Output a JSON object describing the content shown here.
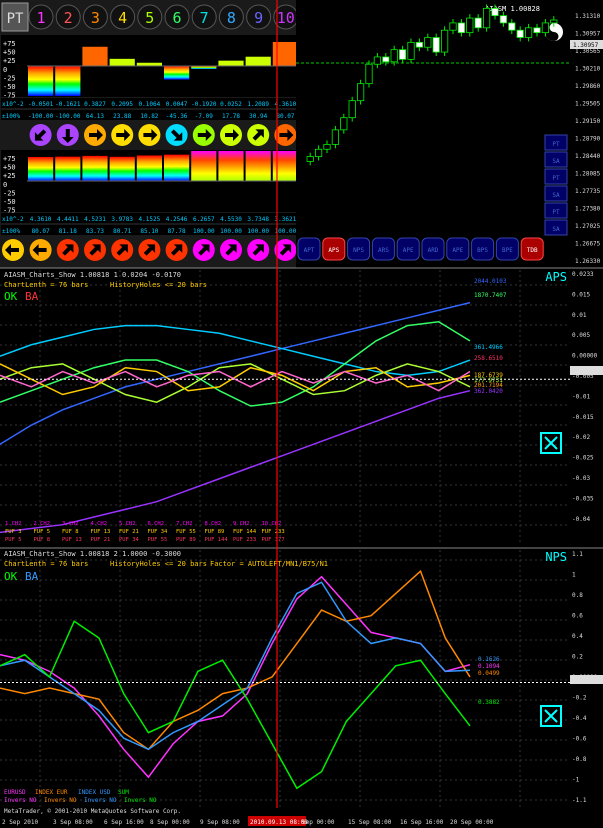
{
  "header": {
    "pt_label": "PT",
    "numbers": [
      "1",
      "2",
      "3",
      "4",
      "5",
      "6",
      "7",
      "8",
      "9",
      "10"
    ],
    "number_colors": [
      "#ff33ff",
      "#ff5555",
      "#ff8800",
      "#ffdd00",
      "#aaff00",
      "#33ff66",
      "#00e0e0",
      "#33aaff",
      "#6666ff",
      "#cc33ff"
    ]
  },
  "top_panel": {
    "yaxis_labels": [
      "+75",
      "+50",
      "+25",
      "0",
      "-25",
      "-50",
      "-75"
    ],
    "row1_prefix": "x10^-2",
    "row1_values": [
      "-0.0501",
      "-0.1621",
      "0.3827",
      "0.2095",
      "0.1064",
      "0.0047",
      "-0.1920",
      "0.0252",
      "1.2089",
      "4.3610"
    ],
    "row2_prefix": "±100%",
    "row2_values": [
      "-100.00",
      "-100.00",
      "64.13",
      "23.88",
      "10.82",
      "-45.36",
      "-7.09",
      "17.78",
      "30.94",
      "80.07"
    ],
    "row3_prefix": "x10^-2",
    "row3_values": [
      "4.3610",
      "4.4411",
      "4.5231",
      "3.9783",
      "4.1525",
      "4.2546",
      "6.2657",
      "4.5530",
      "3.7348",
      "3.3621"
    ],
    "row4_prefix": "±100%",
    "row4_values": [
      "80.07",
      "81.18",
      "83.73",
      "80.71",
      "85.10",
      "87.78",
      "100.00",
      "100.00",
      "100.00",
      "100.00"
    ],
    "arrow_icons_1": [
      "arrow-down-left-icon",
      "arrow-down-icon",
      "arrow-right-icon",
      "arrow-right-icon",
      "arrow-right-icon",
      "arrow-down-right-icon",
      "arrow-right-icon",
      "arrow-right-icon",
      "arrow-up-right-icon",
      "arrow-right-icon"
    ],
    "arrow_icons_2": [
      "arrow-left-icon",
      "arrow-up-right-icon",
      "arrow-up-right-icon",
      "arrow-up-right-icon",
      "arrow-up-right-icon",
      "arrow-up-right-icon",
      "arrow-up-right-icon",
      "arrow-up-right-icon",
      "arrow-up-right-icon",
      "arrow-up-right-icon"
    ]
  },
  "price_panel": {
    "title": "AIASM 1.00828",
    "price_labels": [
      "1.31310",
      "1.30957",
      "1.30565",
      "1.30210",
      "1.29860",
      "1.29505",
      "1.29150",
      "1.28790",
      "1.28440",
      "1.28085",
      "1.27735",
      "1.27380",
      "1.27025",
      "1.26675",
      "1.26330"
    ],
    "current_price": "1.30957",
    "buttons": [
      "APT",
      "APS",
      "NPS",
      "ARS",
      "APE",
      "ARD",
      "APE",
      "BPS",
      "BPE",
      "TDB"
    ],
    "side_buttons": [
      "PT",
      "SA",
      "PT",
      "SA",
      "PT",
      "SA"
    ]
  },
  "aps_panel": {
    "header": "AIASM_Charts_Show 1.00818  1  0.0204  -0.0170",
    "chart_length": "ChartLenth = 76 bars",
    "history": "HistoryHoles <= 20 bars",
    "ok_label": "OK",
    "ba_label": "BA",
    "badge": "APS",
    "badge_value": "0.0233",
    "yaxis_labels": [
      "0.0233",
      "0.015",
      "0.01",
      "0.005",
      "0.00000",
      "-0.005",
      "-0.01",
      "-0.015",
      "-0.02",
      "-0.025",
      "-0.03",
      "-0.035",
      "-0.04"
    ],
    "right_values": [
      "2044.0103",
      "1870.7407",
      "361.4966",
      "258.6510",
      "187.6739",
      "177.9731",
      "201.7194",
      "362.0420"
    ],
    "legend_row1": [
      "1.CH2",
      "2.CH2",
      "3.CH2",
      "4.CH2",
      "5.CH2",
      "6.CH2",
      "7.CH2",
      "8.CH2",
      "9.CH2",
      "10.CH2"
    ],
    "legend_row2": [
      "FUF 3",
      "FUF 5",
      "FUF 8",
      "FUF 13",
      "FUF 21",
      "FUF 34",
      "FUF 55",
      "FUF 89",
      "FUF 144",
      "FUF 233"
    ],
    "legend_row3": [
      "PUF 5",
      "PUF 8",
      "PUF 13",
      "PUF 21",
      "PUF 34",
      "PUF 55",
      "PUF 89",
      "PUF 144",
      "PUF 233",
      "PUF 377"
    ]
  },
  "nps_panel": {
    "header": "AIASM_Charts_Show 1.00818  2  1.0000  -0.3000",
    "chart_length": "ChartLenth = 76 bars",
    "history": "HistoryHoles <= 20 bars",
    "factor": "Factor = AUTOLEFT/MN1/B75/N1",
    "ok_label": "OK",
    "ba_label": "BA",
    "badge": "NPS",
    "yaxis_labels": [
      "1.1",
      "1",
      "0.8",
      "0.6",
      "0.4",
      "0.2",
      "0.00000",
      "-0.2",
      "-0.4",
      "-0.6",
      "-0.8",
      "-1",
      "-1.1"
    ],
    "right_values": [
      "0.1626",
      "0.1094",
      "0.0499",
      "0.3882"
    ],
    "legend_names": [
      "EURUSD",
      "INDEX EUR",
      "INDEX USD",
      "SUM"
    ],
    "legend_invers": [
      "Invers NO",
      "Invers NO",
      "Invers NO",
      "Invers NO"
    ]
  },
  "footer": {
    "copyright": "MetaTrader, © 2001-2010 MetaQuotes Software Corp.",
    "time_labels": [
      "2 Sep 2010",
      "3 Sep 08:00",
      "6 Sep 16:00",
      "8 Sep 00:00",
      "9 Sep 08:00",
      "2010.09.13 08:00",
      "Sep 00:00",
      "15 Sep 08:00",
      "16 Sep 16:00",
      "20 Sep 00:00"
    ]
  },
  "colors": {
    "background": "#000000",
    "cursor_line": "#ff0000",
    "grid": "#444444",
    "axis_text": "#ffffff",
    "aps_badge": "#00ffff",
    "ok": "#00ff00",
    "ba": "#ff3333"
  },
  "chart_data": [
    {
      "type": "line",
      "name": "price",
      "title": "AIASM 1.00828",
      "ylim": [
        1.2633,
        1.3131
      ],
      "x": [
        1,
        2,
        3,
        4,
        5,
        6,
        7,
        8,
        9,
        10,
        11,
        12,
        13,
        14,
        15,
        16,
        17,
        18,
        19,
        20,
        21,
        22,
        23,
        24,
        25,
        26,
        27,
        28,
        29,
        30
      ],
      "values": [
        1.2815,
        1.283,
        1.284,
        1.287,
        1.2895,
        1.293,
        1.2965,
        1.3005,
        1.302,
        1.301,
        1.3035,
        1.3015,
        1.305,
        1.304,
        1.306,
        1.303,
        1.3075,
        1.309,
        1.307,
        1.31,
        1.308,
        1.312,
        1.3105,
        1.309,
        1.3075,
        1.306,
        1.308,
        1.307,
        1.309,
        1.3096
      ]
    },
    {
      "type": "line",
      "name": "APS",
      "ylim": [
        -0.042,
        0.0233
      ],
      "x": [
        0,
        5,
        10,
        15,
        20,
        25,
        30,
        35,
        40,
        45,
        50,
        55,
        60,
        65,
        70,
        75
      ],
      "series": [
        {
          "color": "#3366ff",
          "values": [
            -0.017,
            -0.012,
            -0.008,
            -0.005,
            -0.002,
            0.0,
            0.002,
            0.004,
            0.006,
            0.008,
            0.01,
            0.012,
            0.014,
            0.016,
            0.018,
            0.02
          ]
        },
        {
          "color": "#00ccff",
          "values": [
            0.006,
            0.009,
            0.011,
            0.013,
            0.014,
            0.014,
            0.013,
            0.012,
            0.01,
            0.008,
            0.006,
            0.004,
            0.002,
            0.001,
            0.002,
            0.005
          ]
        },
        {
          "color": "#33ff66",
          "values": [
            -0.006,
            -0.003,
            0.0,
            0.003,
            0.005,
            0.005,
            0.002,
            -0.003,
            -0.007,
            -0.006,
            -0.002,
            0.004,
            0.01,
            0.014,
            0.015,
            0.01
          ]
        },
        {
          "color": "#aaff33",
          "values": [
            0.0,
            0.003,
            0.004,
            0.0,
            -0.004,
            -0.006,
            -0.002,
            0.003,
            0.004,
            0.0,
            -0.004,
            -0.003,
            0.001,
            0.004,
            0.002,
            -0.002
          ]
        },
        {
          "color": "#ffcc00",
          "values": [
            0.004,
            0.0,
            -0.004,
            -0.002,
            0.003,
            0.002,
            -0.003,
            -0.002,
            0.003,
            0.001,
            -0.003,
            0.002,
            0.003,
            -0.002,
            -0.001,
            0.001
          ]
        },
        {
          "color": "#ff66cc",
          "values": [
            0.001,
            -0.002,
            0.002,
            -0.001,
            0.002,
            -0.002,
            0.001,
            0.002,
            -0.002,
            0.002,
            -0.001,
            0.002,
            -0.001,
            0.001,
            -0.003,
            0.002
          ]
        },
        {
          "color": "#9933ff",
          "values": [
            -0.04,
            -0.039,
            -0.038,
            -0.036,
            -0.034,
            -0.032,
            -0.029,
            -0.026,
            -0.023,
            -0.02,
            -0.017,
            -0.014,
            -0.011,
            -0.008,
            -0.005,
            -0.003
          ]
        }
      ]
    },
    {
      "type": "line",
      "name": "NPS",
      "ylim": [
        -1.1,
        1.1
      ],
      "x": [
        0,
        4,
        8,
        12,
        16,
        20,
        24,
        28,
        32,
        36,
        40,
        44,
        48,
        52,
        56,
        60,
        64,
        68,
        72,
        76
      ],
      "series": [
        {
          "name": "EURUSD",
          "color": "#ff33ff",
          "values": [
            0.25,
            0.2,
            0.1,
            -0.05,
            -0.3,
            -0.6,
            -0.85,
            -0.55,
            -0.35,
            -0.3,
            -0.1,
            0.35,
            0.75,
            0.95,
            0.7,
            0.45,
            0.4,
            0.35,
            0.1,
            0.16
          ]
        },
        {
          "name": "INDEX EUR",
          "color": "#ff8800",
          "values": [
            -0.05,
            -0.1,
            -0.05,
            -0.1,
            -0.15,
            -0.45,
            -0.6,
            -0.35,
            -0.25,
            -0.1,
            -0.05,
            0.05,
            0.35,
            0.65,
            0.55,
            0.6,
            0.8,
            1.0,
            0.4,
            0.05
          ]
        },
        {
          "name": "INDEX USD",
          "color": "#3399ff",
          "values": [
            0.15,
            0.2,
            0.05,
            -0.1,
            -0.25,
            -0.5,
            -0.6,
            -0.45,
            -0.35,
            -0.2,
            -0.05,
            0.4,
            0.8,
            0.9,
            0.55,
            0.35,
            0.4,
            0.35,
            0.1,
            0.11
          ]
        },
        {
          "name": "SUM",
          "color": "#00ee00",
          "values": [
            0.15,
            0.25,
            0.05,
            0.55,
            0.4,
            -0.1,
            -0.45,
            -0.35,
            0.1,
            0.2,
            -0.15,
            -0.55,
            -0.95,
            -0.8,
            -0.35,
            -0.1,
            0.15,
            0.2,
            -0.1,
            -0.39
          ]
        }
      ]
    }
  ]
}
